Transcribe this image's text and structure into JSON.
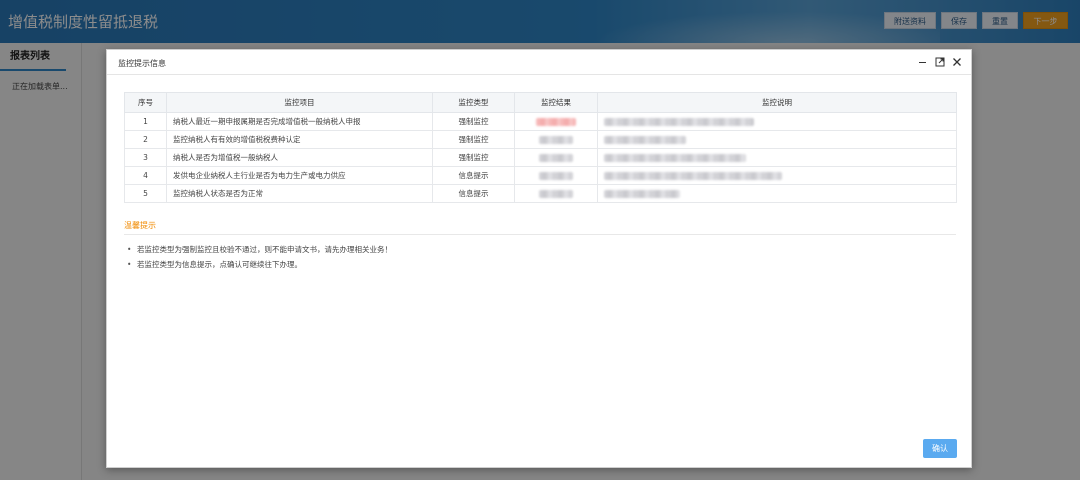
{
  "app": {
    "title": "增值税制度性留抵退税",
    "buttons": {
      "attachments": "附送资料",
      "save": "保存",
      "reset": "重置",
      "next": "下一步"
    }
  },
  "sidebar": {
    "title": "报表列表",
    "loading": "正在加载表单..."
  },
  "modal": {
    "title": "监控提示信息",
    "table": {
      "headers": [
        "序号",
        "监控项目",
        "监控类型",
        "监控结果",
        "监控说明"
      ],
      "rows": [
        {
          "no": "1",
          "item": "纳税人最近一期申报属期是否完成增值税一般纳税人申报",
          "type": "强制监控"
        },
        {
          "no": "2",
          "item": "监控纳税人有有效的增值税税费种认定",
          "type": "强制监控"
        },
        {
          "no": "3",
          "item": "纳税人是否为增值税一般纳税人",
          "type": "强制监控"
        },
        {
          "no": "4",
          "item": "发供电企业纳税人主行业是否为电力生产或电力供应",
          "type": "信息提示"
        },
        {
          "no": "5",
          "item": "监控纳税人状态是否为正常",
          "type": "信息提示"
        }
      ]
    },
    "tips_title": "温馨提示",
    "tips": [
      "若监控类型为强制监控且校验不通过，则不能申请文书，请先办理相关业务！",
      "若监控类型为信息提示，点确认可继续往下办理。"
    ],
    "confirm_label": "确认"
  }
}
